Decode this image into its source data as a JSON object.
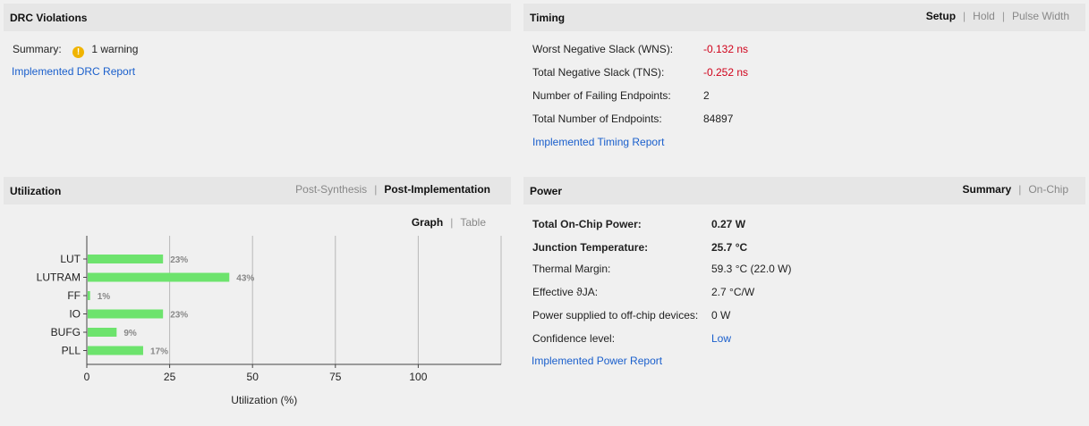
{
  "drc": {
    "title": "DRC Violations",
    "summary_label": "Summary:",
    "summary_value": "1 warning",
    "report_link": "Implemented DRC Report"
  },
  "timing": {
    "title": "Timing",
    "tabs": [
      "Setup",
      "Hold",
      "Pulse Width"
    ],
    "active_tab": "Setup",
    "rows": [
      {
        "label": "Worst Negative Slack (WNS):",
        "value": "-0.132 ns"
      },
      {
        "label": "Total Negative Slack (TNS):",
        "value": "-0.252 ns"
      },
      {
        "label": "Number of Failing Endpoints:",
        "value": "2"
      },
      {
        "label": "Total Number of Endpoints:",
        "value": "84897"
      }
    ],
    "report_link": "Implemented Timing Report",
    "negative_color": "#d0021b"
  },
  "utilization": {
    "title": "Utilization",
    "tabs": [
      "Post-Synthesis",
      "Post-Implementation"
    ],
    "active_tab": "Post-Implementation",
    "view_tabs": [
      "Graph",
      "Table"
    ],
    "active_view": "Graph"
  },
  "chart_data": {
    "type": "bar",
    "orientation": "horizontal",
    "categories": [
      "LUT",
      "LUTRAM",
      "FF",
      "IO",
      "BUFG",
      "PLL"
    ],
    "values": [
      23,
      43,
      1,
      23,
      9,
      17
    ],
    "data_labels": [
      "23%",
      "43%",
      "1%",
      "23%",
      "9%",
      "17%"
    ],
    "xlabel": "Utilization (%)",
    "xticks": [
      0,
      25,
      50,
      75,
      100
    ],
    "xlim": [
      0,
      125
    ],
    "grid": true,
    "bar_color": "#6de36d"
  },
  "power": {
    "title": "Power",
    "tabs": [
      "Summary",
      "On-Chip"
    ],
    "active_tab": "Summary",
    "rows": [
      {
        "label": "Total On-Chip Power:",
        "value": "0.27 W"
      },
      {
        "label": "Junction Temperature:",
        "value": "25.7 °C"
      },
      {
        "label": "Thermal Margin:",
        "value": "59.3 °C (22.0 W)"
      },
      {
        "label": "Effective ϑJA:",
        "value": "2.7 °C/W"
      },
      {
        "label": "Power supplied to off-chip devices:",
        "value": "0 W"
      },
      {
        "label": "Confidence level:",
        "value": "Low"
      }
    ],
    "report_link": "Implemented Power Report"
  },
  "colors": {
    "background": "#f0f0f0",
    "header": "#e6e6e6",
    "link": "#1a5fcc"
  }
}
